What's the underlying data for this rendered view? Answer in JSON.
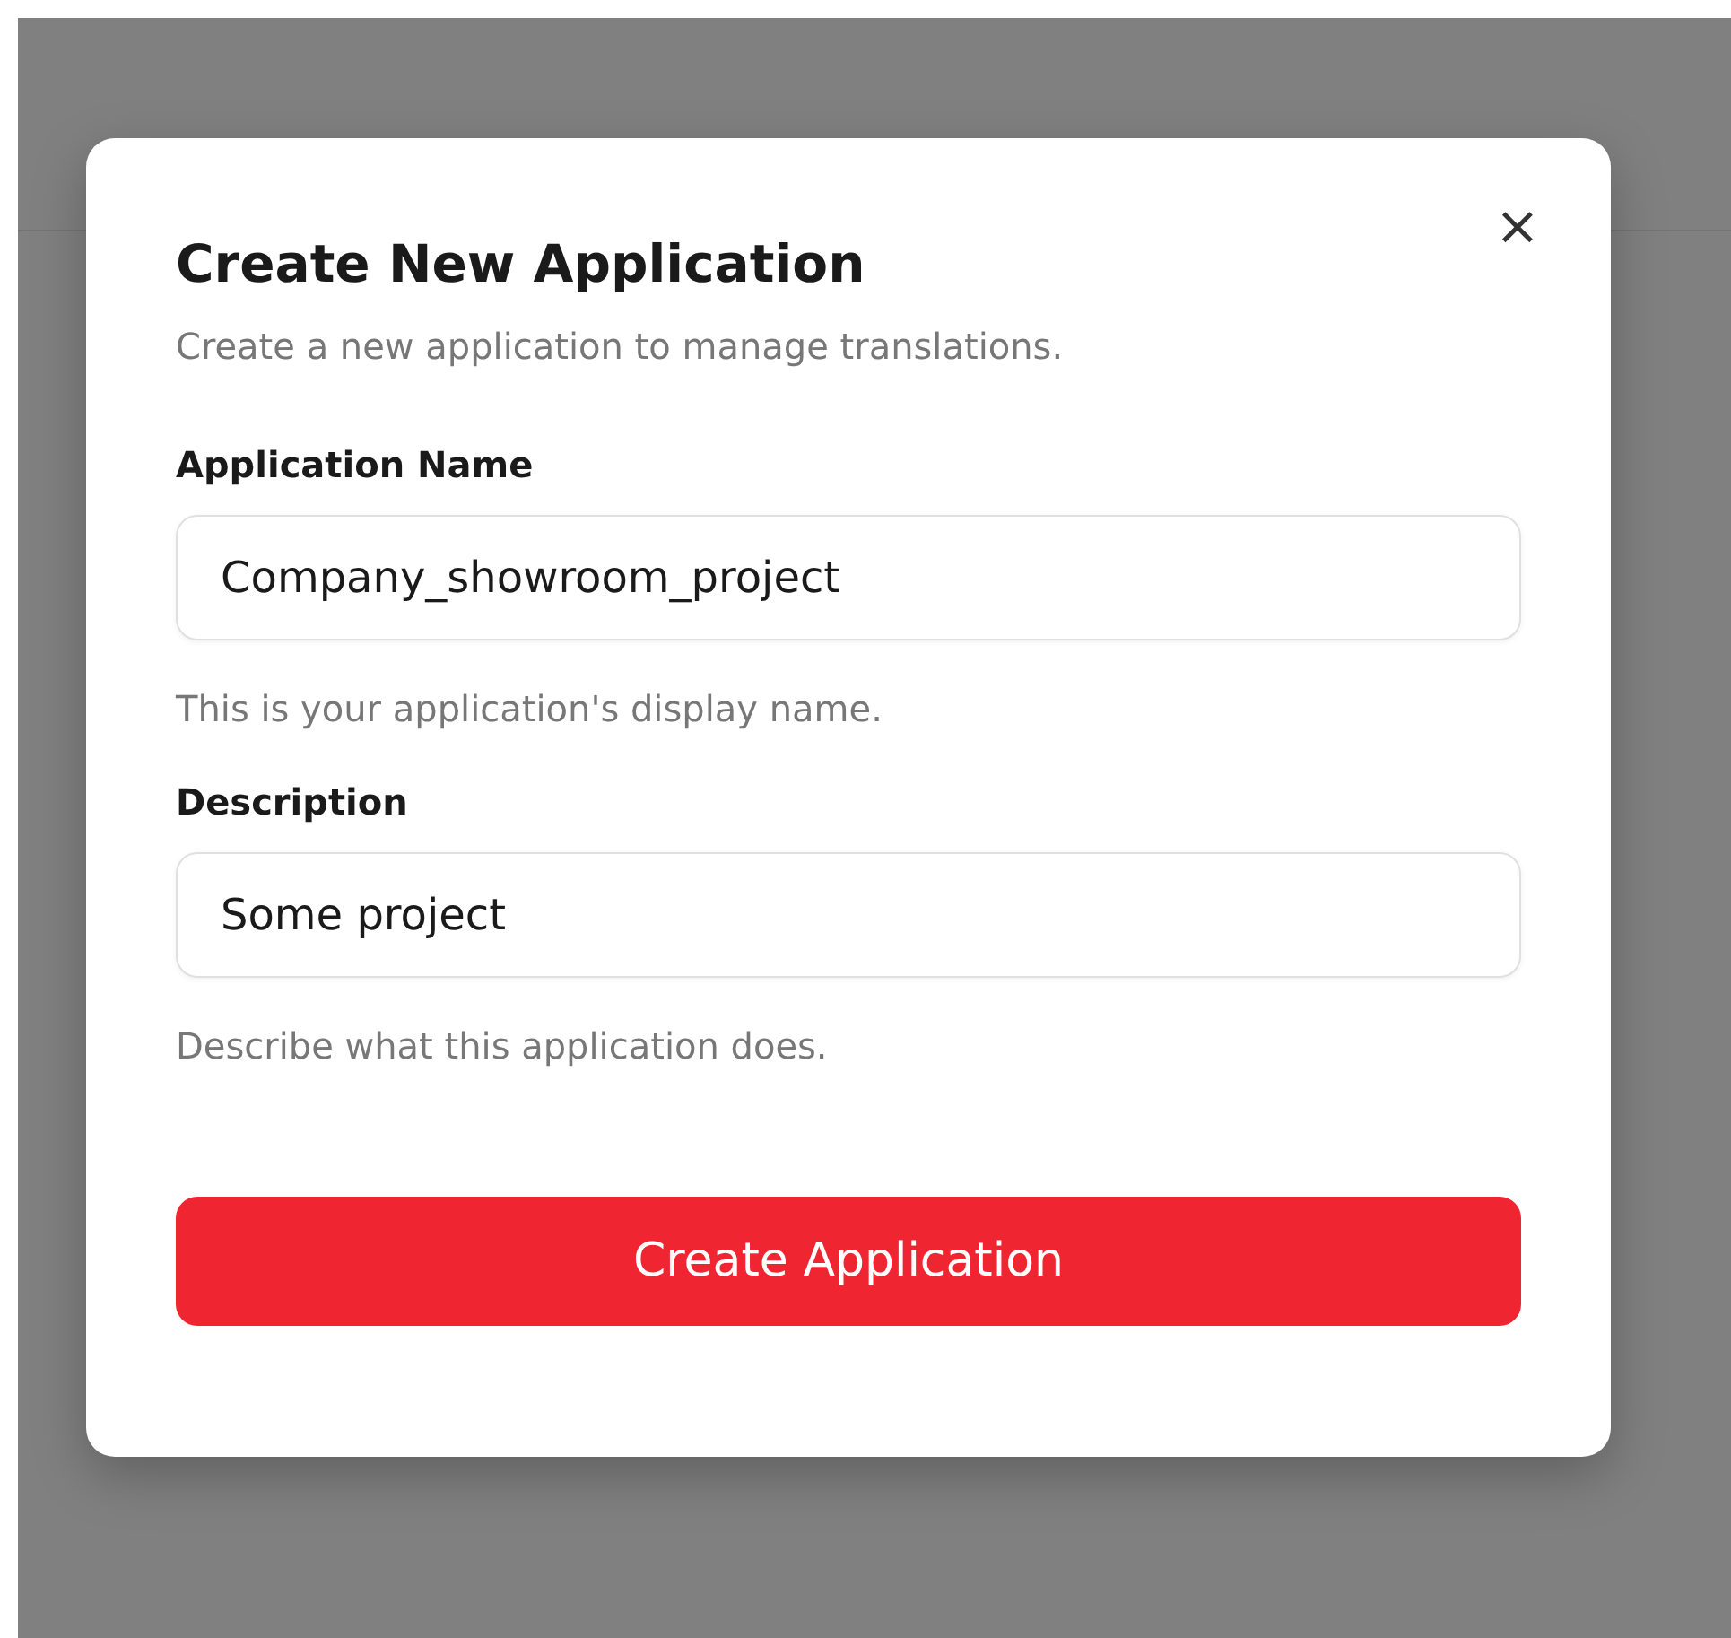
{
  "dialog": {
    "title": "Create New Application",
    "close_icon": "×",
    "subtitle": "Create a new application to manage translations.",
    "fields": [
      {
        "label": "Application Name",
        "value": "Company_showroom_project",
        "help": "This is your application's display name."
      },
      {
        "label": "Description",
        "value": "Some project",
        "help": "Describe what this application does."
      }
    ],
    "submit": "Create Application"
  }
}
